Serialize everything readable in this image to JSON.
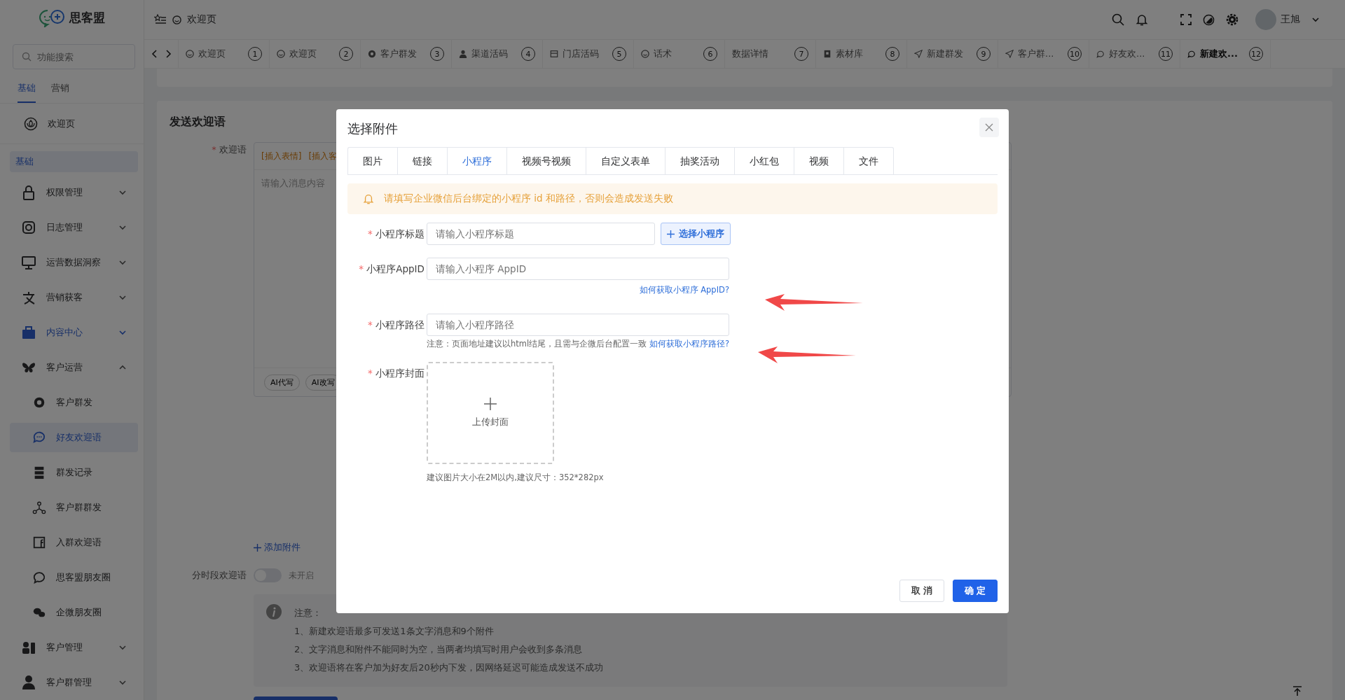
{
  "logo": {
    "text": "思客盟"
  },
  "header": {
    "breadcrumb": "欢迎页",
    "user": "王旭"
  },
  "search": {
    "placeholder": "功能搜索"
  },
  "sidebar": {
    "tabs": [
      {
        "label": "基础",
        "selected": true
      },
      {
        "label": "营销",
        "selected": false
      }
    ],
    "home": "欢迎页",
    "section": "基础",
    "items": [
      {
        "label": "权限管理",
        "expanded": false,
        "highlighted": false
      },
      {
        "label": "日志管理",
        "expanded": false,
        "highlighted": false
      },
      {
        "label": "运营数据洞察",
        "expanded": false,
        "highlighted": false
      },
      {
        "label": "营销获客",
        "expanded": false,
        "highlighted": false
      },
      {
        "label": "内容中心",
        "expanded": false,
        "highlighted": true
      },
      {
        "label": "客户运营",
        "expanded": true,
        "highlighted": false,
        "children": [
          {
            "label": "客户群发",
            "selected": false
          },
          {
            "label": "好友欢迎语",
            "selected": true
          },
          {
            "label": "群发记录",
            "selected": false
          },
          {
            "label": "客户群群发",
            "selected": false
          },
          {
            "label": "入群欢迎语",
            "selected": false
          },
          {
            "label": "思客盟朋友圈",
            "selected": false
          },
          {
            "label": "企微朋友圈",
            "selected": false
          }
        ]
      },
      {
        "label": "客户管理",
        "expanded": false,
        "highlighted": false
      },
      {
        "label": "客户群管理",
        "expanded": false,
        "highlighted": false
      }
    ]
  },
  "page_tabs": [
    {
      "label": "欢迎页",
      "number": "1",
      "selected": false
    },
    {
      "label": "欢迎页",
      "number": "2",
      "selected": false
    },
    {
      "label": "客户群发",
      "number": "3",
      "selected": false
    },
    {
      "label": "渠道活码",
      "number": "4",
      "selected": false
    },
    {
      "label": "门店活码",
      "number": "5",
      "selected": false
    },
    {
      "label": "话术",
      "number": "6",
      "selected": false
    },
    {
      "label": "数据详情",
      "number": "7",
      "selected": false
    },
    {
      "label": "素材库",
      "number": "8",
      "selected": false
    },
    {
      "label": "新建群发",
      "number": "9",
      "selected": false
    },
    {
      "label": "客户群...",
      "number": "10",
      "selected": false
    },
    {
      "label": "好友欢...",
      "number": "11",
      "selected": false
    },
    {
      "label": "新建欢...",
      "number": "12",
      "selected": true
    }
  ],
  "form": {
    "title": "发送欢迎语",
    "welcome_label": "欢迎语",
    "required_mark": "*",
    "editor": {
      "toolbar": [
        "[插入表情]",
        "[插入客"
      ],
      "placeholder": "请输入消息内容",
      "ai_buttons": [
        "AI代写",
        "AI改写"
      ]
    },
    "add_attachment": "添加附件",
    "schedule": {
      "label": "分时段欢迎语",
      "on": false,
      "status": "未开启"
    },
    "notice": {
      "title": "注意：",
      "lines": [
        "1、新建欢迎语最多可发送1条文字消息和9个附件",
        "2、文字消息和附件不能同时为空，当两者均填写时用户会收到多条消息",
        "3、欢迎语将在客户加为好友后20秒内下发，因网络延迟可能造成发送不成功"
      ]
    }
  },
  "dialog": {
    "title": "选择附件",
    "tabs": [
      {
        "label": "图片",
        "selected": false
      },
      {
        "label": "链接",
        "selected": false
      },
      {
        "label": "小程序",
        "selected": true
      },
      {
        "label": "视频号视频",
        "selected": false
      },
      {
        "label": "自定义表单",
        "selected": false
      },
      {
        "label": "抽奖活动",
        "selected": false
      },
      {
        "label": "小红包",
        "selected": false
      },
      {
        "label": "视频",
        "selected": false
      },
      {
        "label": "文件",
        "selected": false
      }
    ],
    "alert": "请填写企业微信后台绑定的小程序 id 和路径，否则会造成发送失败",
    "fields": [
      {
        "kind": "input",
        "label": "小程序标题",
        "required_mark": "*",
        "placeholder": "请输入小程序标题",
        "action": "选择小程序"
      },
      {
        "kind": "input",
        "label": "小程序AppID",
        "required_mark": "*",
        "placeholder": "请输入小程序 AppID",
        "help_link": "如何获取小程序 AppID?"
      },
      {
        "kind": "input",
        "label": "小程序路径",
        "required_mark": "*",
        "placeholder": "请输入小程序路径",
        "note": "注意：页面地址建议以html结尾，且需与企微后台配置一致",
        "help_link": "如何获取小程序路径?"
      },
      {
        "kind": "upload",
        "label": "小程序封面",
        "required_mark": "*",
        "upload_text": "上传封面",
        "hint": "建议图片大小在2M以内,建议尺寸：352*282px"
      }
    ],
    "buttons": [
      {
        "label": "取 消",
        "kind": "default"
      },
      {
        "label": "确 定",
        "kind": "primary"
      }
    ]
  }
}
